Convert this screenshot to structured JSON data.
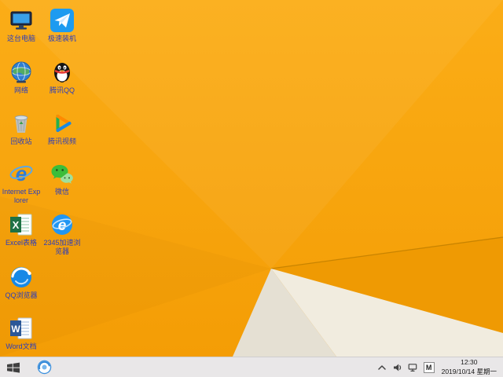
{
  "theme": {
    "wallpaper_orange": "#f8a312",
    "wallpaper_orange_light": "#fbad17",
    "wallpaper_orange_dark": "#ef9a03",
    "wallpaper_crease_line": "#c98400",
    "wallpaper_wedge_light": "#f1ecdf",
    "wallpaper_wedge_shadow": "#e5e0d3",
    "taskbar_bg": "#e9e7e8",
    "icon_label_color": "#2a3dbd"
  },
  "desktop": {
    "icons": [
      {
        "name": "this-pc",
        "label": "这台电脑"
      },
      {
        "name": "network",
        "label": "网络"
      },
      {
        "name": "recycle-bin",
        "label": "回收站"
      },
      {
        "name": "internet-explorer",
        "label": "Internet Explorer"
      },
      {
        "name": "excel",
        "label": "Excel表格"
      },
      {
        "name": "qq-browser",
        "label": "QQ浏览器"
      },
      {
        "name": "word",
        "label": "Word文档"
      },
      {
        "name": "quick-install",
        "label": "极速装机"
      },
      {
        "name": "tencent-qq",
        "label": "腾讯QQ"
      },
      {
        "name": "tencent-video",
        "label": "腾讯视频"
      },
      {
        "name": "wechat",
        "label": "微信"
      },
      {
        "name": "browser-2345",
        "label": "2345加速浏览器"
      }
    ]
  },
  "taskbar": {
    "pinned_icons": [
      "start-button",
      "browser-icon"
    ],
    "tray_icons": [
      "hidden-icons-caret",
      "volume-icon",
      "network-icon",
      "input-method-indicator"
    ],
    "input_method": "M",
    "clock": {
      "time": "12:30",
      "date": "2019/10/14 星期一"
    }
  }
}
